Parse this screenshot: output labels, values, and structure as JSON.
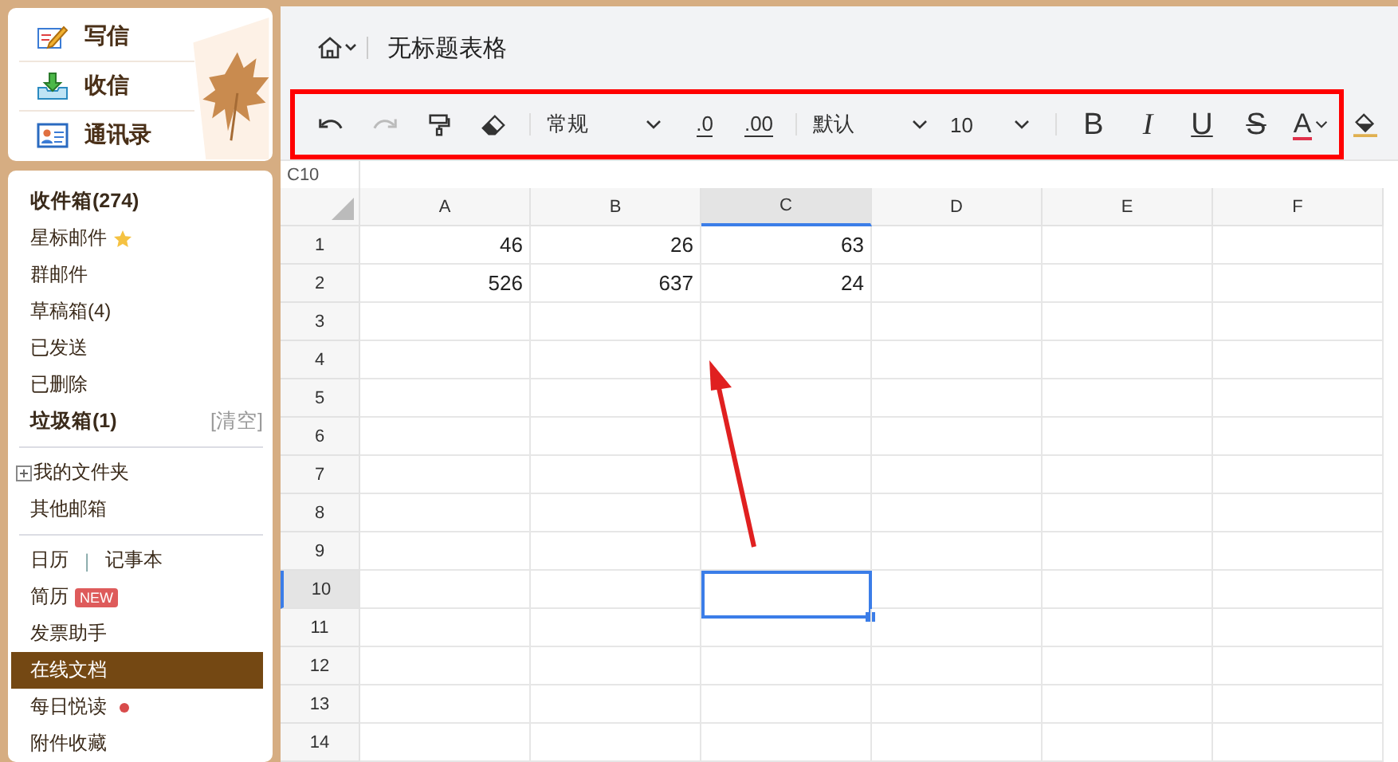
{
  "sidebar": {
    "actions": [
      {
        "label": "写信",
        "kind": "compose"
      },
      {
        "label": "收信",
        "kind": "inbox"
      },
      {
        "label": "通讯录",
        "kind": "contacts"
      }
    ],
    "groups": [
      [
        {
          "kind": "plain",
          "label": "收件箱(274)",
          "bold": true,
          "selected": false
        },
        {
          "kind": "starred",
          "label": "星标邮件",
          "bold": false,
          "selected": false
        },
        {
          "kind": "plain",
          "label": "群邮件",
          "bold": false,
          "selected": false
        },
        {
          "kind": "plain",
          "label": "草稿箱(4)",
          "bold": false,
          "selected": false
        },
        {
          "kind": "plain",
          "label": "已发送",
          "bold": false,
          "selected": false
        },
        {
          "kind": "plain",
          "label": "已删除",
          "bold": false,
          "selected": false
        },
        {
          "kind": "action",
          "label": "垃圾箱(1)",
          "action": "[清空]",
          "bold": true,
          "selected": false
        }
      ],
      [
        {
          "kind": "folder",
          "label": "我的文件夹",
          "bold": false,
          "selected": false
        },
        {
          "kind": "plain",
          "label": "其他邮箱",
          "bold": false,
          "selected": false
        }
      ],
      [
        {
          "kind": "split",
          "labels": [
            "日历",
            "记事本"
          ],
          "separator": "|",
          "bold": false,
          "selected": false
        },
        {
          "kind": "badge",
          "label": "简历",
          "badge": "NEW",
          "bold": false,
          "selected": false
        },
        {
          "kind": "plain",
          "label": "发票助手",
          "bold": false,
          "selected": false
        },
        {
          "kind": "plain",
          "label": "在线文档",
          "bold": false,
          "selected": true
        },
        {
          "kind": "dot",
          "label": "每日悦读",
          "bold": false,
          "selected": false
        },
        {
          "kind": "plain",
          "label": "附件收藏",
          "bold": false,
          "selected": false
        }
      ]
    ]
  },
  "document": {
    "title": "无标题表格"
  },
  "toolbar": [
    {
      "kind": "undo",
      "disabled": false
    },
    {
      "kind": "redo",
      "disabled": true
    },
    {
      "kind": "painter",
      "disabled": false
    },
    {
      "kind": "eraser",
      "disabled": false
    },
    {
      "kind": "sep"
    },
    {
      "kind": "select",
      "value": "常规",
      "wide": true
    },
    {
      "kind": "dec-less",
      "label": ".0",
      "disabled": false
    },
    {
      "kind": "dec-more",
      "label": ".00",
      "disabled": false
    },
    {
      "kind": "sep"
    },
    {
      "kind": "select",
      "value": "默认",
      "wide": true
    },
    {
      "kind": "select",
      "value": "10",
      "wide": false
    },
    {
      "kind": "sep"
    },
    {
      "kind": "bold",
      "label": "B",
      "disabled": false
    },
    {
      "kind": "italic",
      "label": "I",
      "disabled": false
    },
    {
      "kind": "underline",
      "label": "U",
      "disabled": false
    },
    {
      "kind": "strike",
      "label": "S",
      "disabled": false
    },
    {
      "kind": "font-color",
      "label": "A",
      "disabled": false
    },
    {
      "kind": "fill-color",
      "disabled": false
    }
  ],
  "sheet": {
    "name_box": "C10",
    "columns": [
      {
        "label": "A",
        "selected": false
      },
      {
        "label": "B",
        "selected": false
      },
      {
        "label": "C",
        "selected": true
      },
      {
        "label": "D",
        "selected": false
      },
      {
        "label": "E",
        "selected": false
      },
      {
        "label": "F",
        "selected": false
      }
    ],
    "rows": [
      {
        "label": "1",
        "selected": false,
        "cells": [
          "46",
          "26",
          "63",
          "",
          "",
          ""
        ]
      },
      {
        "label": "2",
        "selected": false,
        "cells": [
          "526",
          "637",
          "24",
          "",
          "",
          ""
        ]
      },
      {
        "label": "3",
        "selected": false,
        "cells": [
          "",
          "",
          "",
          "",
          "",
          ""
        ]
      },
      {
        "label": "4",
        "selected": false,
        "cells": [
          "",
          "",
          "",
          "",
          "",
          ""
        ]
      },
      {
        "label": "5",
        "selected": false,
        "cells": [
          "",
          "",
          "",
          "",
          "",
          ""
        ]
      },
      {
        "label": "6",
        "selected": false,
        "cells": [
          "",
          "",
          "",
          "",
          "",
          ""
        ]
      },
      {
        "label": "7",
        "selected": false,
        "cells": [
          "",
          "",
          "",
          "",
          "",
          ""
        ]
      },
      {
        "label": "8",
        "selected": false,
        "cells": [
          "",
          "",
          "",
          "",
          "",
          ""
        ]
      },
      {
        "label": "9",
        "selected": false,
        "cells": [
          "",
          "",
          "",
          "",
          "",
          ""
        ]
      },
      {
        "label": "10",
        "selected": true,
        "cells": [
          "",
          "",
          "",
          "",
          "",
          ""
        ]
      },
      {
        "label": "11",
        "selected": false,
        "cells": [
          "",
          "",
          "",
          "",
          "",
          ""
        ]
      },
      {
        "label": "12",
        "selected": false,
        "cells": [
          "",
          "",
          "",
          "",
          "",
          ""
        ]
      },
      {
        "label": "13",
        "selected": false,
        "cells": [
          "",
          "",
          "",
          "",
          "",
          ""
        ]
      },
      {
        "label": "14",
        "selected": false,
        "cells": [
          "",
          "",
          "",
          "",
          "",
          ""
        ]
      }
    ]
  }
}
